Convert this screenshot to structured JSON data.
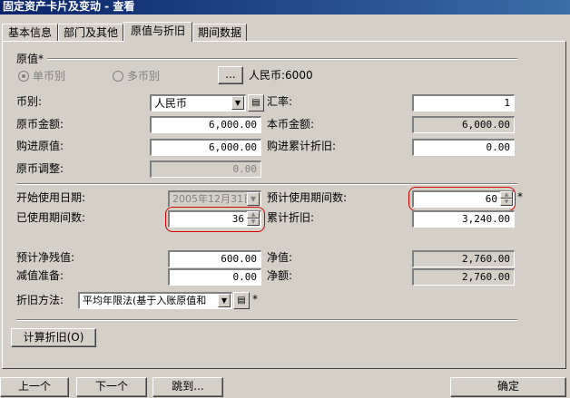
{
  "window": {
    "title": "固定资产卡片及变动 - 查看"
  },
  "tabs": [
    {
      "label": "基本信息",
      "active": false
    },
    {
      "label": "部门及其他",
      "active": false
    },
    {
      "label": "原值与折旧",
      "active": true
    },
    {
      "label": "期间数据",
      "active": false
    }
  ],
  "original": {
    "group_label": "原值*",
    "single_currency": "单币别",
    "multi_currency": "多币别",
    "currency_btn": "...",
    "currency_summary": "人民币:6000"
  },
  "fields": {
    "currency_label": "币别:",
    "currency_value": "人民币",
    "rate_label": "汇率:",
    "rate_value": "1",
    "orig_amount_label": "原币金额:",
    "orig_amount_value": "6,000.00",
    "local_amount_label": "本币金额:",
    "local_amount_value": "6,000.00",
    "purchase_value_label": "购进原值:",
    "purchase_value_value": "6,000.00",
    "purchase_dep_label": "购进累计折旧:",
    "purchase_dep_value": "0.00",
    "adjust_label": "原币调整:",
    "adjust_value": "0.00"
  },
  "depreciation": {
    "start_date_label": "开始使用日期:",
    "start_date_value": "2005年12月31日",
    "est_periods_label": "预计使用期间数:",
    "est_periods_value": "60",
    "est_periods_required": "*",
    "used_periods_label": "已使用期间数:",
    "used_periods_value": "36",
    "accum_dep_label": "累计折旧:",
    "accum_dep_value": "3,240.00",
    "est_residual_label": "预计净残值:",
    "est_residual_value": "600.00",
    "net_value_label": "净值:",
    "net_value_value": "2,760.00",
    "impairment_label": "减值准备:",
    "impairment_value": "0.00",
    "net_amount_label": "净额:",
    "net_amount_value": "2,760.00",
    "method_label": "折旧方法:",
    "method_value": "平均年限法(基于入账原值和",
    "method_required": "*"
  },
  "buttons": {
    "calc": "计算折旧(O)",
    "prev": "上一个",
    "next": "下一个",
    "jump": "跳到...",
    "ok": "确定"
  }
}
